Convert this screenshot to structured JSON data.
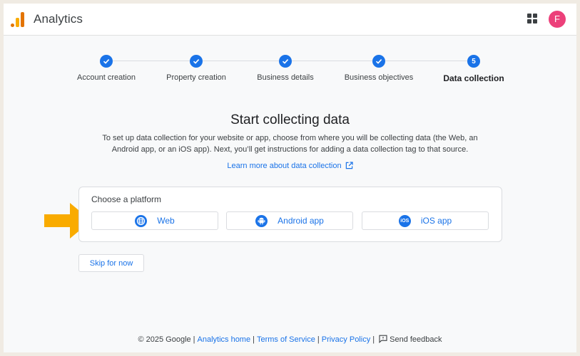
{
  "app": {
    "title": "Analytics",
    "avatar_initial": "F"
  },
  "colors": {
    "accent": "#1a73e8",
    "avatar": "#ec407a",
    "arrow": "#f9ab00",
    "logo_orange": "#f9ab00",
    "logo_dark_orange": "#e37400"
  },
  "stepper": {
    "steps": [
      {
        "label": "Account creation",
        "state": "done"
      },
      {
        "label": "Property creation",
        "state": "done"
      },
      {
        "label": "Business details",
        "state": "done"
      },
      {
        "label": "Business objectives",
        "state": "done"
      },
      {
        "label": "Data collection",
        "state": "active",
        "number": "5"
      }
    ]
  },
  "main": {
    "heading": "Start collecting data",
    "description": "To set up data collection for your website or app, choose from where you will be collecting data (the Web, an Android app, or an iOS app). Next, you’ll get instructions for adding a data collection tag to that source.",
    "learn_more": "Learn more about data collection",
    "platform_card": {
      "title": "Choose a platform",
      "options": [
        {
          "label": "Web",
          "icon": "globe-icon"
        },
        {
          "label": "Android app",
          "icon": "android-icon"
        },
        {
          "label": "iOS app",
          "icon": "ios-icon",
          "icon_text": "iOS"
        }
      ]
    },
    "skip_label": "Skip for now"
  },
  "footer": {
    "copyright": "© 2025 Google",
    "links": [
      "Analytics home",
      "Terms of Service",
      "Privacy Policy"
    ],
    "separator": "|",
    "feedback": "Send feedback"
  }
}
